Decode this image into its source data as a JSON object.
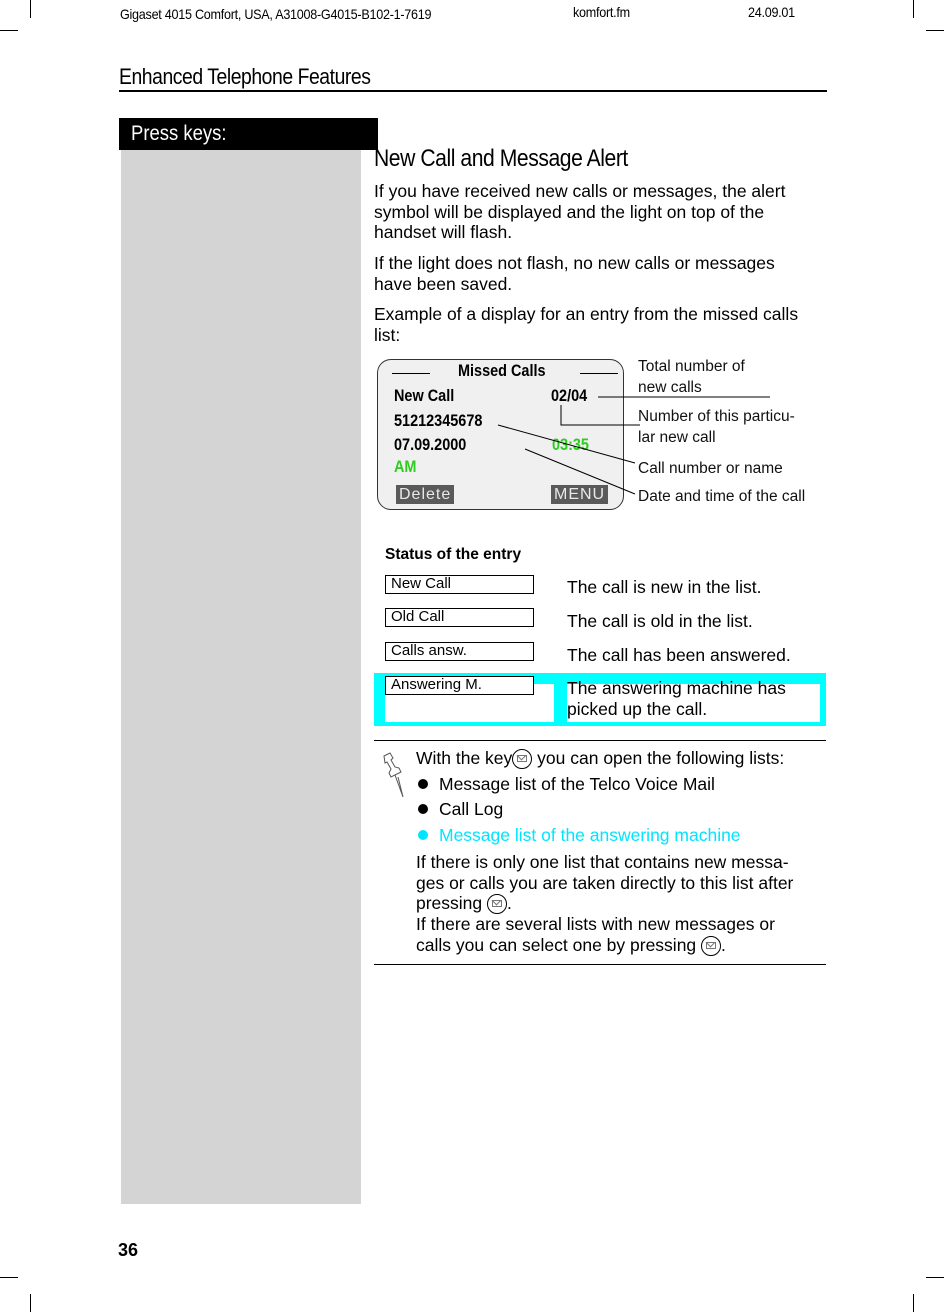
{
  "header": {
    "doc_info": "Gigaset 4015 Comfort, USA, A31008-G4015-B102-1-7619",
    "file_name": "komfort.fm",
    "date": "24.09.01",
    "section_title": "Enhanced Telephone Features"
  },
  "sidebar": {
    "label": "Press keys:"
  },
  "main": {
    "heading": "New Call and Message Alert",
    "paragraphs": [
      [
        "If you have received new calls or messages, the alert",
        "symbol will be displayed and the light on top of the",
        "handset will flash."
      ],
      [
        "If the light does not flash, no new calls or messages",
        "have been saved."
      ],
      [
        "Example of a display for an entry from the missed calls",
        "list:"
      ]
    ]
  },
  "display": {
    "title": "Missed Calls",
    "status": "New Call",
    "counter": "02/04",
    "number": "51212345678",
    "date": "07.09.2000",
    "time": "03:35",
    "ampm": "AM",
    "left_softkey": "Delete",
    "right_softkey": "MENU",
    "accent_color": "#2ecc1e"
  },
  "callouts": {
    "total": [
      "Total number of",
      "new calls"
    ],
    "this_call": [
      "Number of this particu-",
      "lar new call"
    ],
    "number": "Call number or name",
    "datetime": "Date and time  of the call"
  },
  "status_table": {
    "heading": "Status of the entry",
    "rows": [
      {
        "label": "New Call",
        "description": [
          "The call is new in the list."
        ]
      },
      {
        "label": "Old Call",
        "description": [
          "The call is old in the list."
        ]
      },
      {
        "label": "Calls answ.",
        "description": [
          "The call has been answered."
        ]
      },
      {
        "label": "Answering M.",
        "description": [
          "The answering machine has",
          "picked up the call."
        ],
        "highlight": "#00ffff"
      }
    ]
  },
  "note": {
    "icon": "pushpin-icon",
    "intro_before": "With the key",
    "intro_after": " you can open the following lists:",
    "items": [
      {
        "text": "Message list of the Telco Voice Mail",
        "color": "#000000"
      },
      {
        "text": "Call Log",
        "color": "#000000"
      },
      {
        "text": "Message list of the answering machine",
        "color": "#00e5ff"
      }
    ],
    "para1": [
      "If there is only one list that contains new messa-",
      "ges or calls you are taken directly to this list after"
    ],
    "para1_end_before": "pressing ",
    "para1_end_after": ".",
    "para2": [
      "If there are several lists with new messages or"
    ],
    "para2_end_before": "calls you can select one by pressing ",
    "para2_end_after": ".",
    "key_icon": "message-key-icon"
  },
  "footer": {
    "page_number": "36"
  }
}
